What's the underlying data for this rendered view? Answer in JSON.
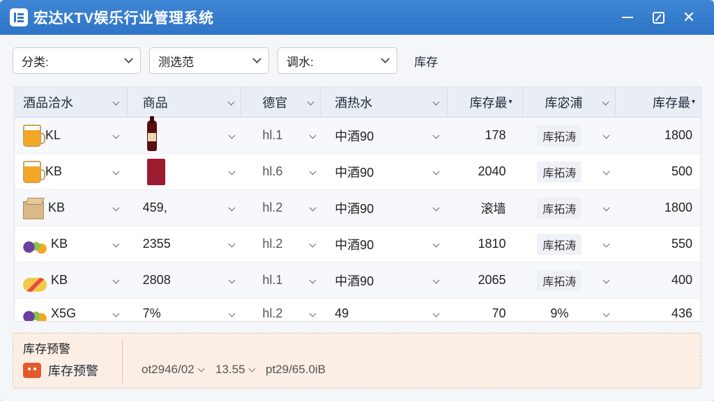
{
  "title": "宏达KTV娱乐行业管理系统",
  "filters": [
    {
      "label": "分类:"
    },
    {
      "label": "测选范"
    },
    {
      "label": "调水:"
    }
  ],
  "filter_trailing_label": "库存",
  "columns": [
    "酒品洽水",
    "商品",
    "德官",
    "酒热水",
    "库存最",
    "库宓浦",
    "库存最"
  ],
  "rows": [
    {
      "name": "KL",
      "icon": "beer-icon",
      "product": "",
      "product_icon": "wine-bottle-icon",
      "sku": "hl.1",
      "type": "中酒90",
      "stock": "178",
      "status": "库拓涛",
      "stock2": "1800"
    },
    {
      "name": "KB",
      "icon": "beer-icon",
      "product": "",
      "product_icon": "wine-box-icon",
      "sku": "hl.6",
      "type": "中酒90",
      "stock": "2040",
      "status": "库拓涛",
      "stock2": "500"
    },
    {
      "name": "KB",
      "icon": "box-icon",
      "product": "459,",
      "product_icon": "",
      "sku": "hl.2",
      "type": "中酒90",
      "stock": "滚墙",
      "status": "库拓涛",
      "stock2": "1800"
    },
    {
      "name": "KB",
      "icon": "fruit-icon",
      "product": "2355",
      "product_icon": "",
      "sku": "hl.2",
      "type": "中酒90",
      "stock": "1810",
      "status": "库拓涛",
      "stock2": "550"
    },
    {
      "name": "KB",
      "icon": "cheese-plate-icon",
      "product": "2808",
      "product_icon": "",
      "sku": "hl.1",
      "type": "中酒90",
      "stock": "2065",
      "status": "库拓涛",
      "stock2": "400"
    },
    {
      "name": "X5G",
      "icon": "fruit-icon",
      "product": "7%",
      "product_icon": "",
      "sku": "hl.2",
      "type": "49",
      "stock": "70",
      "status": "9%",
      "stock2": "436"
    }
  ],
  "bottom": {
    "title": "库存预警",
    "alert_label": "库存预警",
    "stat1": "ot2946/02",
    "stat2": "13.55",
    "stat3": "pt29/65.0iB"
  },
  "colors": {
    "titlebar": "#2f74c6",
    "alert": "#e25a2c",
    "warning_bg": "#fbeee4"
  }
}
